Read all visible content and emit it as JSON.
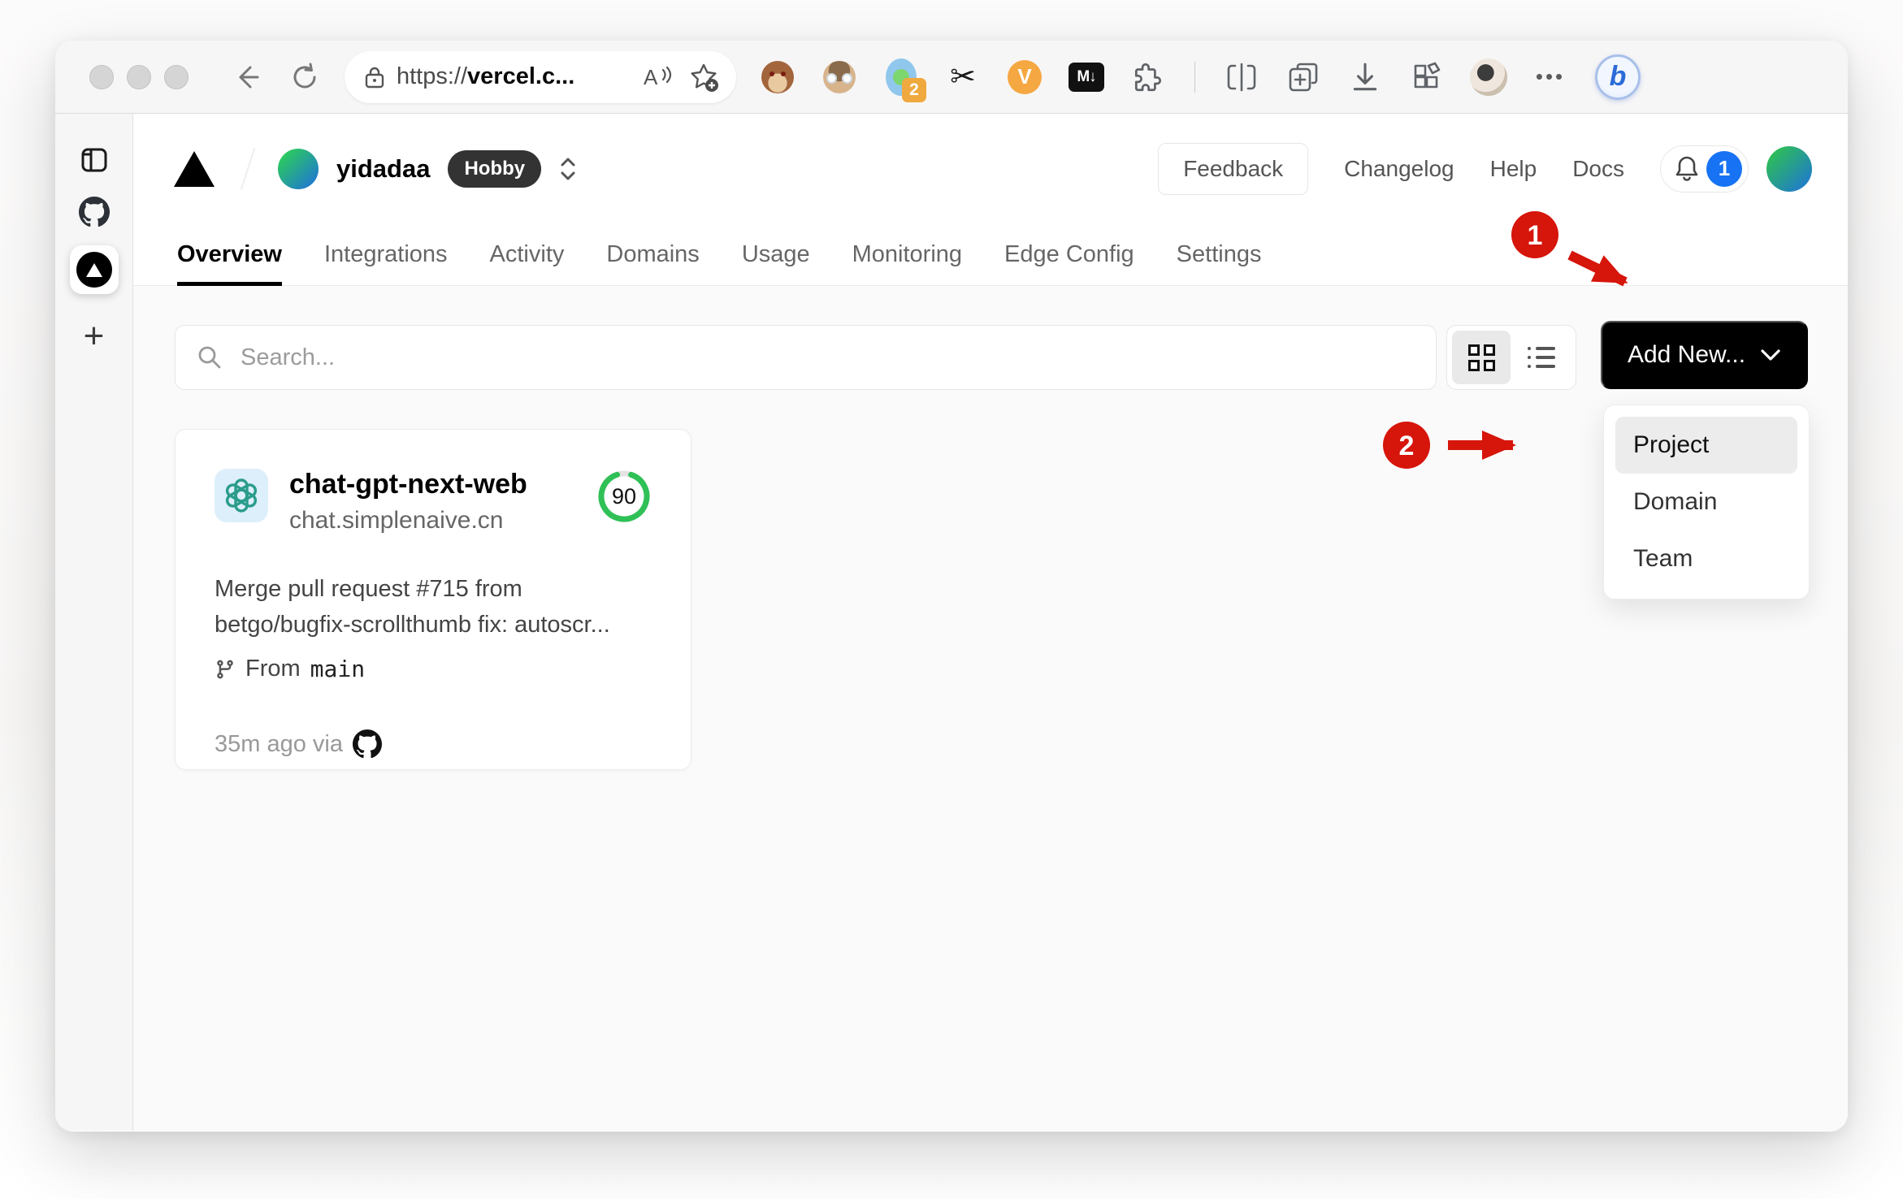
{
  "browser": {
    "url_scheme": "https://",
    "url_host": "vercel.c...",
    "extension_badge_count": "2",
    "vimium_label": "V",
    "markdown_label": "M↓",
    "scissors_glyph": "✂",
    "more_label": "•••",
    "bing_label": "b"
  },
  "header": {
    "team_name": "yidadaa",
    "plan_badge": "Hobby",
    "feedback_label": "Feedback",
    "links": [
      {
        "label": "Changelog"
      },
      {
        "label": "Help"
      },
      {
        "label": "Docs"
      }
    ],
    "notification_count": "1"
  },
  "tabs": [
    {
      "label": "Overview",
      "active": true
    },
    {
      "label": "Integrations"
    },
    {
      "label": "Activity"
    },
    {
      "label": "Domains"
    },
    {
      "label": "Usage"
    },
    {
      "label": "Monitoring"
    },
    {
      "label": "Edge Config"
    },
    {
      "label": "Settings"
    }
  ],
  "toolbar": {
    "search_placeholder": "Search...",
    "add_new_label": "Add New..."
  },
  "dropdown": {
    "items": [
      {
        "label": "Project",
        "highlighted": true
      },
      {
        "label": "Domain"
      },
      {
        "label": "Team"
      }
    ]
  },
  "project_card": {
    "name": "chat-gpt-next-web",
    "domain": "chat.simplenaive.cn",
    "score": "90",
    "commit_message": "Merge pull request #715 from betgo/bugfix-scrollthumb fix: autoscr...",
    "branch_prefix": "From",
    "branch": "main",
    "deployed": "35m ago via"
  },
  "annotations": {
    "step1": "1",
    "step2": "2"
  },
  "colors": {
    "annotation_red": "#d6150b",
    "ring_green": "#2fc056",
    "badge_blue": "#1773f3",
    "accent_black": "#000000",
    "openai_teal": "#2b9c8c",
    "chrome_gray": "#f6f6f6"
  }
}
